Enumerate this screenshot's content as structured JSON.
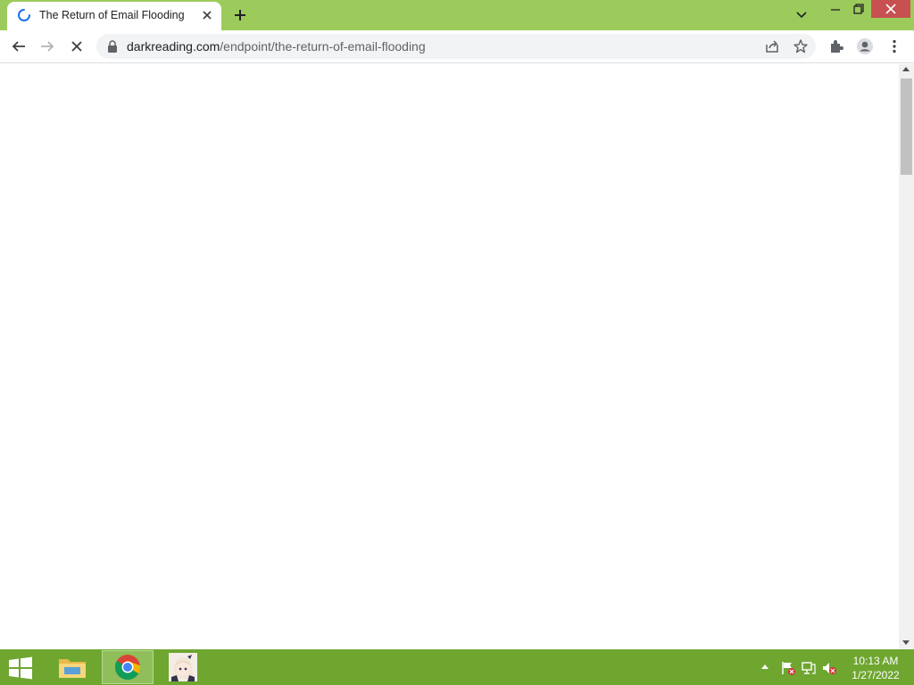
{
  "browser": {
    "tab": {
      "title": "The Return of Email Flooding",
      "loading": true
    },
    "address_bar": {
      "domain": "darkreading.com",
      "path": "/endpoint/the-return-of-email-flooding"
    },
    "theme": {
      "frame_color": "#9ccb5c",
      "close_color": "#c75050"
    }
  },
  "taskbar": {
    "color": "#6ea630",
    "apps": [
      {
        "name": "File Explorer"
      },
      {
        "name": "Google Chrome",
        "active": true
      },
      {
        "name": "Anime character app"
      }
    ],
    "clock": {
      "time": "10:13 AM",
      "date": "1/27/2022"
    }
  }
}
